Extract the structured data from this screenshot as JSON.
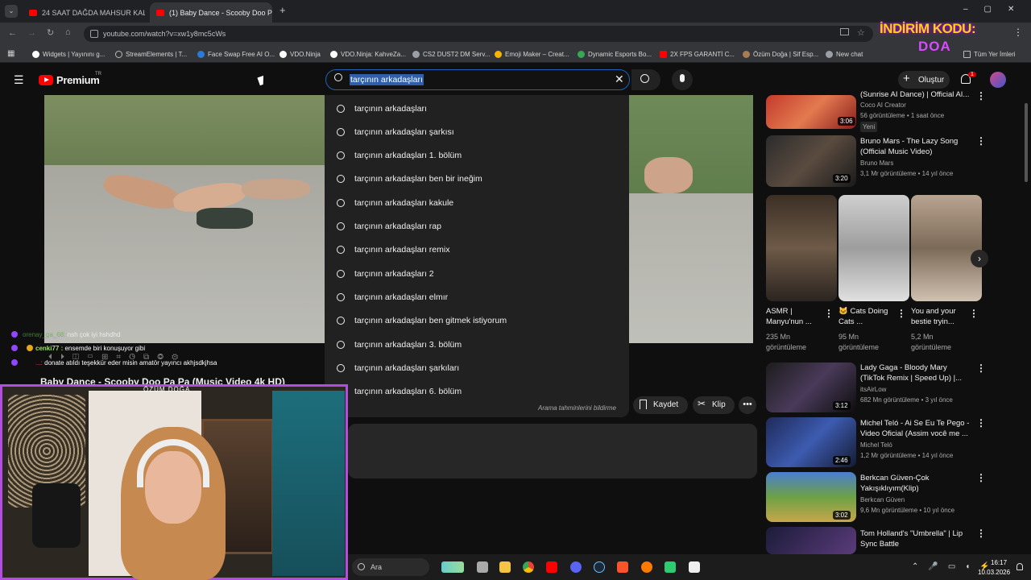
{
  "browser": {
    "tabs": [
      {
        "title": "24 SAAT DAĞDA MAHSUR KAL!"
      },
      {
        "title": "(1) Baby Dance - Scooby Doo P"
      }
    ],
    "url": "youtube.com/watch?v=xw1y8mc5cWs",
    "bookmarks": [
      "Widgets | Yayınını g...",
      "StreamElements | T...",
      "Face Swap Free AI O...",
      "VDO.Ninja",
      "VDO.Ninja: KahveZa...",
      "CS2 DUST2 DM Serv...",
      "Emoji Maker – Creat...",
      "Dynamic Esports Bo...",
      "2X FPS GARANTİ C...",
      "Özüm Doğa | Sif Esp...",
      "New chat"
    ],
    "bookmarks_right": "Tüm Yer İmleri"
  },
  "overlay": {
    "promo_line1": "İNDİRİM KODU:",
    "promo_line2": "DOA"
  },
  "youtube": {
    "logo": "Premium",
    "logo_sup": "TR",
    "search_value": "tarçının arkadaşları",
    "create_label": "Oluştur",
    "notif_count": "1",
    "suggestions": [
      "tarçının arkadaşları",
      "tarçının arkadaşları şarkısı",
      "tarçının arkadaşları 1. bölüm",
      "tarçının arkadaşları ben bir ineğim",
      "tarçının arkadaşları kakule",
      "tarçının arkadaşları rap",
      "tarçının arkadaşları remix",
      "tarçının arkadaşları 2",
      "tarçının arkadaşları elmır",
      "tarçının arkadaşları ben gitmek istiyorum",
      "tarçının arkadaşları 3. bölüm",
      "tarçının arkadaşları şarkıları",
      "tarçının arkadaşları 6. bölüm"
    ],
    "report_link": "Arama tahminlerini bildirme",
    "video_title": "Baby Dance - Scooby Doo Pa Pa (Music Video 4k HD)",
    "save_label": "Kaydet",
    "clip_label": "Klip",
    "sidebar": [
      {
        "title": "(Sunrise AI Dance) | Official AI...",
        "channel": "Coco AI Creator",
        "meta": "56 görüntüleme • 1 saat önce",
        "badge": "Yeni",
        "duration": "3:06"
      },
      {
        "title": "Bruno Mars - The Lazy Song (Official Music Video)",
        "channel": "Bruno Mars",
        "meta": "3,1 Mr görüntüleme • 14 yıl önce",
        "duration": "3:20"
      },
      {
        "title": "Lady Gaga - Bloody Mary (TikTok Remix | Speed Up) |...",
        "channel": "itsAirLow",
        "meta": "682 Mn görüntüleme • 3 yıl önce",
        "duration": "3:12"
      },
      {
        "title": "Michel Teló - Ai Se Eu Te Pego - Video Oficial (Assim você me ...",
        "channel": "Michel Teló",
        "meta": "1,2 Mr görüntüleme • 14 yıl önce",
        "duration": "2:46"
      },
      {
        "title": "Berkcan Güven-Çok Yakışıklıyım(Klip)",
        "channel": "Berkcan Güven",
        "meta": "9,6 Mn görüntüleme • 10 yıl önce",
        "duration": "3:02"
      },
      {
        "title": "Tom Holland's \"Umbrella\" | Lip Sync Battle",
        "channel": "",
        "meta": "",
        "duration": ""
      }
    ],
    "shorts": [
      {
        "title": "ASMR | Manyu'nun ...",
        "views": "235 Mn",
        "suffix": "görüntüleme"
      },
      {
        "title": "🐱 Cats Doing Cats ...",
        "views": "95 Mn",
        "suffix": "görüntüleme"
      },
      {
        "title": "You and your bestie tryin...",
        "views": "5,2 Mn",
        "suffix": "görüntüleme"
      }
    ]
  },
  "stream": {
    "cam_label": "ÖZÜM DOĞA",
    "chat": [
      {
        "user": "orenay_ga_68:",
        "msg": "nsh çok iyi hshdhd"
      },
      {
        "user": "cenki77 :",
        "msg": "ensemde biri konuşuyor gibi"
      },
      {
        "user": "...:",
        "msg": "donate atıldı teşekkür eder misin amatör yayıncı akhjsdkjhsa"
      }
    ]
  },
  "taskbar": {
    "search": "Ara",
    "time": "16:17",
    "date": "10.03.2026"
  },
  "colors": {
    "accent": "#3ea6ff",
    "youtube_red": "#ff0000",
    "cam_border": "#b34ce0"
  }
}
